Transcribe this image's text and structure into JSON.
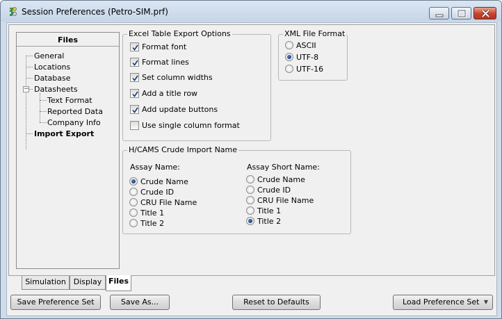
{
  "window": {
    "title": "Session Preferences (Petro-SIM.prf)"
  },
  "tree": {
    "header": "Files",
    "items": [
      {
        "label": "General"
      },
      {
        "label": "Locations"
      },
      {
        "label": "Database"
      },
      {
        "label": "Datasheets",
        "expanded": true
      },
      {
        "label": "Text Format"
      },
      {
        "label": "Reported Data"
      },
      {
        "label": "Company Info"
      },
      {
        "label": "Import Export",
        "selected": true
      }
    ]
  },
  "excel_options": {
    "title": "Excel Table Export Options",
    "items": [
      {
        "label": "Format font",
        "checked": true
      },
      {
        "label": "Format lines",
        "checked": true
      },
      {
        "label": "Set column widths",
        "checked": true
      },
      {
        "label": "Add a title row",
        "checked": true
      },
      {
        "label": "Add update buttons",
        "checked": true
      },
      {
        "label": "Use single column format",
        "checked": false
      }
    ]
  },
  "xml_format": {
    "title": "XML File Format",
    "options": [
      "ASCII",
      "UTF-8",
      "UTF-16"
    ],
    "selected": "UTF-8"
  },
  "crude_import": {
    "title": "H/CAMS Crude Import Name",
    "assay_name": {
      "label": "Assay Name:",
      "options": [
        "Crude Name",
        "Crude ID",
        "CRU File Name",
        "Title 1",
        "Title 2"
      ],
      "selected": "Crude Name"
    },
    "assay_short_name": {
      "label": "Assay Short Name:",
      "options": [
        "Crude Name",
        "Crude ID",
        "CRU File Name",
        "Title 1",
        "Title 2"
      ],
      "selected": "Title 2"
    }
  },
  "tabs": [
    {
      "label": "Simulation"
    },
    {
      "label": "Display"
    },
    {
      "label": "Files",
      "active": true
    }
  ],
  "buttons": {
    "save_set": "Save Preference Set",
    "save_as": "Save As...",
    "reset": "Reset to Defaults",
    "load_set": "Load Preference Set"
  }
}
